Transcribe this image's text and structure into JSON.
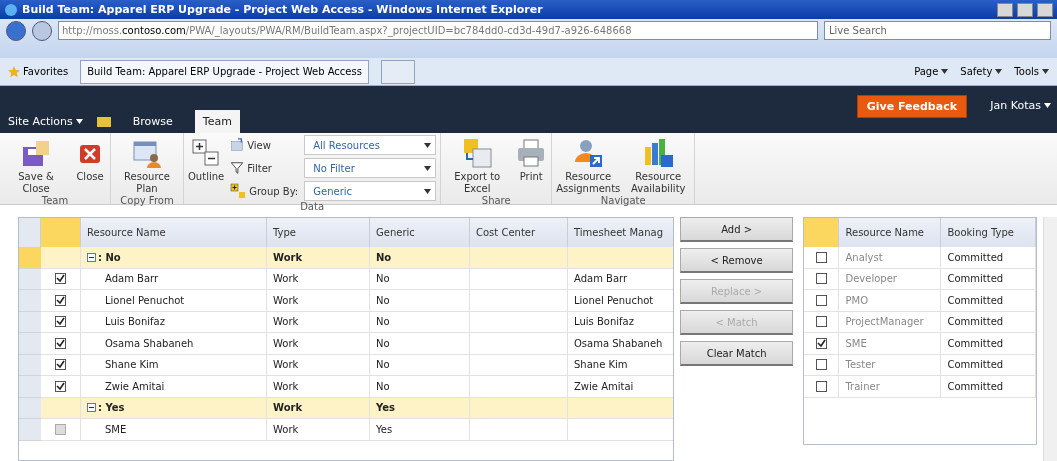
{
  "browser": {
    "title": "Build Team: Apparel ERP Upgrade - Project Web Access - Windows Internet Explorer",
    "url_start": "http://moss.",
    "url_domain": "contoso.com",
    "url_end": "/PWA/_layouts/PWA/RM/BuildTeam.aspx?_projectUID=bc784dd0-cd3d-49d7-a926-648668",
    "search_placeholder": "Live Search",
    "favorites": "Favorites",
    "tab": "Build Team: Apparel ERP Upgrade - Project Web Access",
    "commands": [
      "Page",
      "Safety",
      "Tools"
    ]
  },
  "header": {
    "site_actions": "Site Actions",
    "feedback": "Give Feedback",
    "user": "Jan Kotas",
    "tabs": [
      {
        "label": "Browse",
        "selected": false
      },
      {
        "label": "Team",
        "selected": true
      }
    ]
  },
  "ribbon": [
    {
      "label": "Team",
      "items": [
        {
          "kind": "save",
          "label": "Save & Close"
        },
        {
          "kind": "close",
          "label": "Close"
        }
      ]
    },
    {
      "label": "Copy From",
      "items": [
        {
          "kind": "plan",
          "label": "Resource Plan"
        }
      ]
    },
    {
      "label": "Data",
      "items": [
        {
          "kind": "outline",
          "label": "Outline"
        },
        {
          "kind": "fields",
          "rows": [
            {
              "kind": "view",
              "label": "View",
              "value": "All Resources"
            },
            {
              "kind": "filter",
              "label": "Filter",
              "value": "No Filter"
            },
            {
              "kind": "group",
              "label": "Group By:",
              "value": "Generic"
            }
          ]
        }
      ]
    },
    {
      "label": "Share",
      "items": [
        {
          "kind": "excel",
          "label": "Export to Excel"
        },
        {
          "kind": "print",
          "label": "Print"
        }
      ]
    },
    {
      "label": "Navigate",
      "items": [
        {
          "kind": "assign",
          "label": "Resource Assignments"
        },
        {
          "kind": "avail",
          "label": "Resource Availability"
        }
      ]
    }
  ],
  "left_grid": {
    "columns": [
      "Resource Name",
      "Type",
      "Generic",
      "Cost Center",
      "Timesheet Manag"
    ],
    "rows": [
      {
        "kind": "group",
        "cells": [
          ": No",
          "Work",
          "No",
          "",
          ""
        ]
      },
      {
        "kind": "item",
        "checked": true,
        "disabled": false,
        "cells": [
          "Adam Barr",
          "Work",
          "No",
          "",
          "Adam Barr"
        ]
      },
      {
        "kind": "item",
        "checked": true,
        "disabled": false,
        "cells": [
          "Lionel Penuchot",
          "Work",
          "No",
          "",
          "Lionel Penuchot"
        ]
      },
      {
        "kind": "item",
        "checked": true,
        "disabled": false,
        "cells": [
          "Luis Bonifaz",
          "Work",
          "No",
          "",
          "Luis Bonifaz"
        ]
      },
      {
        "kind": "item",
        "checked": true,
        "disabled": false,
        "cells": [
          "Osama Shabaneh",
          "Work",
          "No",
          "",
          "Osama Shabaneh"
        ]
      },
      {
        "kind": "item",
        "checked": true,
        "disabled": false,
        "cells": [
          "Shane Kim",
          "Work",
          "No",
          "",
          "Shane Kim"
        ]
      },
      {
        "kind": "item",
        "checked": true,
        "disabled": false,
        "cells": [
          "Zwie Amitai",
          "Work",
          "No",
          "",
          "Zwie Amitai"
        ]
      },
      {
        "kind": "group",
        "cells": [
          ": Yes",
          "Work",
          "Yes",
          "",
          ""
        ]
      },
      {
        "kind": "item",
        "checked": false,
        "disabled": true,
        "cells": [
          "SME",
          "Work",
          "Yes",
          "",
          ""
        ]
      }
    ]
  },
  "buttons": [
    {
      "label": "Add >",
      "disabled": false
    },
    {
      "label": "< Remove",
      "disabled": false
    },
    {
      "label": "Replace >",
      "disabled": true
    },
    {
      "label": "< Match",
      "disabled": true
    },
    {
      "label": "Clear Match",
      "disabled": false
    }
  ],
  "right_grid": {
    "columns": [
      "Resource Name",
      "Booking Type"
    ],
    "rows": [
      {
        "checked": false,
        "cells": [
          "Analyst",
          "Committed"
        ]
      },
      {
        "checked": false,
        "cells": [
          "Developer",
          "Committed"
        ]
      },
      {
        "checked": false,
        "cells": [
          "PMO",
          "Committed"
        ]
      },
      {
        "checked": false,
        "cells": [
          "ProjectManager",
          "Committed"
        ]
      },
      {
        "checked": true,
        "cells": [
          "SME",
          "Committed"
        ]
      },
      {
        "checked": false,
        "cells": [
          "Tester",
          "Committed"
        ]
      },
      {
        "checked": false,
        "cells": [
          "Trainer",
          "Committed"
        ]
      }
    ]
  }
}
